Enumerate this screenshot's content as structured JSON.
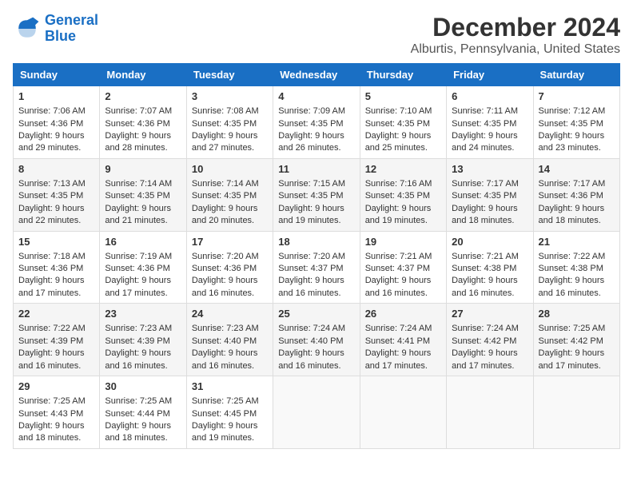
{
  "logo": {
    "line1": "General",
    "line2": "Blue"
  },
  "title": "December 2024",
  "subtitle": "Alburtis, Pennsylvania, United States",
  "headers": [
    "Sunday",
    "Monday",
    "Tuesday",
    "Wednesday",
    "Thursday",
    "Friday",
    "Saturday"
  ],
  "weeks": [
    [
      {
        "day": "1",
        "sunrise": "Sunrise: 7:06 AM",
        "sunset": "Sunset: 4:36 PM",
        "daylight": "Daylight: 9 hours and 29 minutes."
      },
      {
        "day": "2",
        "sunrise": "Sunrise: 7:07 AM",
        "sunset": "Sunset: 4:36 PM",
        "daylight": "Daylight: 9 hours and 28 minutes."
      },
      {
        "day": "3",
        "sunrise": "Sunrise: 7:08 AM",
        "sunset": "Sunset: 4:35 PM",
        "daylight": "Daylight: 9 hours and 27 minutes."
      },
      {
        "day": "4",
        "sunrise": "Sunrise: 7:09 AM",
        "sunset": "Sunset: 4:35 PM",
        "daylight": "Daylight: 9 hours and 26 minutes."
      },
      {
        "day": "5",
        "sunrise": "Sunrise: 7:10 AM",
        "sunset": "Sunset: 4:35 PM",
        "daylight": "Daylight: 9 hours and 25 minutes."
      },
      {
        "day": "6",
        "sunrise": "Sunrise: 7:11 AM",
        "sunset": "Sunset: 4:35 PM",
        "daylight": "Daylight: 9 hours and 24 minutes."
      },
      {
        "day": "7",
        "sunrise": "Sunrise: 7:12 AM",
        "sunset": "Sunset: 4:35 PM",
        "daylight": "Daylight: 9 hours and 23 minutes."
      }
    ],
    [
      {
        "day": "8",
        "sunrise": "Sunrise: 7:13 AM",
        "sunset": "Sunset: 4:35 PM",
        "daylight": "Daylight: 9 hours and 22 minutes."
      },
      {
        "day": "9",
        "sunrise": "Sunrise: 7:14 AM",
        "sunset": "Sunset: 4:35 PM",
        "daylight": "Daylight: 9 hours and 21 minutes."
      },
      {
        "day": "10",
        "sunrise": "Sunrise: 7:14 AM",
        "sunset": "Sunset: 4:35 PM",
        "daylight": "Daylight: 9 hours and 20 minutes."
      },
      {
        "day": "11",
        "sunrise": "Sunrise: 7:15 AM",
        "sunset": "Sunset: 4:35 PM",
        "daylight": "Daylight: 9 hours and 19 minutes."
      },
      {
        "day": "12",
        "sunrise": "Sunrise: 7:16 AM",
        "sunset": "Sunset: 4:35 PM",
        "daylight": "Daylight: 9 hours and 19 minutes."
      },
      {
        "day": "13",
        "sunrise": "Sunrise: 7:17 AM",
        "sunset": "Sunset: 4:35 PM",
        "daylight": "Daylight: 9 hours and 18 minutes."
      },
      {
        "day": "14",
        "sunrise": "Sunrise: 7:17 AM",
        "sunset": "Sunset: 4:36 PM",
        "daylight": "Daylight: 9 hours and 18 minutes."
      }
    ],
    [
      {
        "day": "15",
        "sunrise": "Sunrise: 7:18 AM",
        "sunset": "Sunset: 4:36 PM",
        "daylight": "Daylight: 9 hours and 17 minutes."
      },
      {
        "day": "16",
        "sunrise": "Sunrise: 7:19 AM",
        "sunset": "Sunset: 4:36 PM",
        "daylight": "Daylight: 9 hours and 17 minutes."
      },
      {
        "day": "17",
        "sunrise": "Sunrise: 7:20 AM",
        "sunset": "Sunset: 4:36 PM",
        "daylight": "Daylight: 9 hours and 16 minutes."
      },
      {
        "day": "18",
        "sunrise": "Sunrise: 7:20 AM",
        "sunset": "Sunset: 4:37 PM",
        "daylight": "Daylight: 9 hours and 16 minutes."
      },
      {
        "day": "19",
        "sunrise": "Sunrise: 7:21 AM",
        "sunset": "Sunset: 4:37 PM",
        "daylight": "Daylight: 9 hours and 16 minutes."
      },
      {
        "day": "20",
        "sunrise": "Sunrise: 7:21 AM",
        "sunset": "Sunset: 4:38 PM",
        "daylight": "Daylight: 9 hours and 16 minutes."
      },
      {
        "day": "21",
        "sunrise": "Sunrise: 7:22 AM",
        "sunset": "Sunset: 4:38 PM",
        "daylight": "Daylight: 9 hours and 16 minutes."
      }
    ],
    [
      {
        "day": "22",
        "sunrise": "Sunrise: 7:22 AM",
        "sunset": "Sunset: 4:39 PM",
        "daylight": "Daylight: 9 hours and 16 minutes."
      },
      {
        "day": "23",
        "sunrise": "Sunrise: 7:23 AM",
        "sunset": "Sunset: 4:39 PM",
        "daylight": "Daylight: 9 hours and 16 minutes."
      },
      {
        "day": "24",
        "sunrise": "Sunrise: 7:23 AM",
        "sunset": "Sunset: 4:40 PM",
        "daylight": "Daylight: 9 hours and 16 minutes."
      },
      {
        "day": "25",
        "sunrise": "Sunrise: 7:24 AM",
        "sunset": "Sunset: 4:40 PM",
        "daylight": "Daylight: 9 hours and 16 minutes."
      },
      {
        "day": "26",
        "sunrise": "Sunrise: 7:24 AM",
        "sunset": "Sunset: 4:41 PM",
        "daylight": "Daylight: 9 hours and 17 minutes."
      },
      {
        "day": "27",
        "sunrise": "Sunrise: 7:24 AM",
        "sunset": "Sunset: 4:42 PM",
        "daylight": "Daylight: 9 hours and 17 minutes."
      },
      {
        "day": "28",
        "sunrise": "Sunrise: 7:25 AM",
        "sunset": "Sunset: 4:42 PM",
        "daylight": "Daylight: 9 hours and 17 minutes."
      }
    ],
    [
      {
        "day": "29",
        "sunrise": "Sunrise: 7:25 AM",
        "sunset": "Sunset: 4:43 PM",
        "daylight": "Daylight: 9 hours and 18 minutes."
      },
      {
        "day": "30",
        "sunrise": "Sunrise: 7:25 AM",
        "sunset": "Sunset: 4:44 PM",
        "daylight": "Daylight: 9 hours and 18 minutes."
      },
      {
        "day": "31",
        "sunrise": "Sunrise: 7:25 AM",
        "sunset": "Sunset: 4:45 PM",
        "daylight": "Daylight: 9 hours and 19 minutes."
      },
      null,
      null,
      null,
      null
    ]
  ]
}
